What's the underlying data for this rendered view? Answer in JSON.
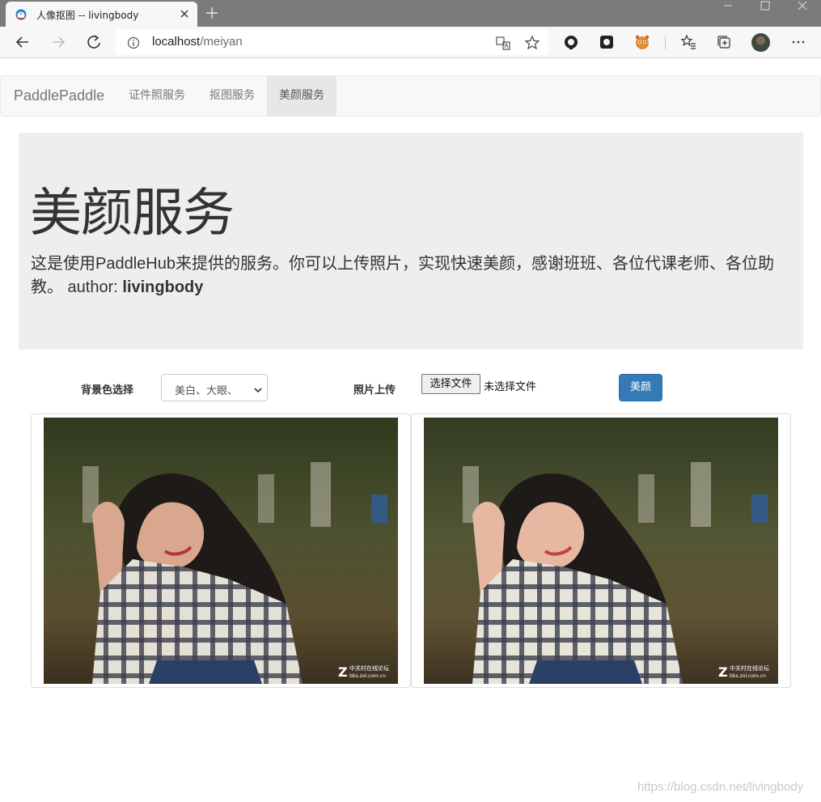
{
  "browser": {
    "tab_title": "人像抠图 -- livingbody",
    "url_host": "localhost",
    "url_path": "/meiyan"
  },
  "navbar": {
    "brand": "PaddlePaddle",
    "links": [
      {
        "label": "证件照服务"
      },
      {
        "label": "抠图服务"
      },
      {
        "label": "美颜服务"
      }
    ]
  },
  "jumbotron": {
    "title": "美颜服务",
    "description": "这是使用PaddleHub来提供的服务。你可以上传照片，实现快速美颜，感谢班班、各位代课老师、各位助教。 author: ",
    "author": "livingbody"
  },
  "form": {
    "bg_label": "背景色选择",
    "bg_selected": "美白、大眼、",
    "upload_label": "照片上传",
    "file_button": "选择文件",
    "file_status": "未选择文件",
    "submit_label": "美颜"
  },
  "images": {
    "watermark_line1": "中关村在线论坛",
    "watermark_line2": "bbs.zol.com.cn"
  },
  "page_watermark": "https://blog.csdn.net/livingbody",
  "colors": {
    "primary": "#337ab7",
    "jumbotron_bg": "#eeeeee",
    "navbar_bg": "#f8f8f8"
  }
}
